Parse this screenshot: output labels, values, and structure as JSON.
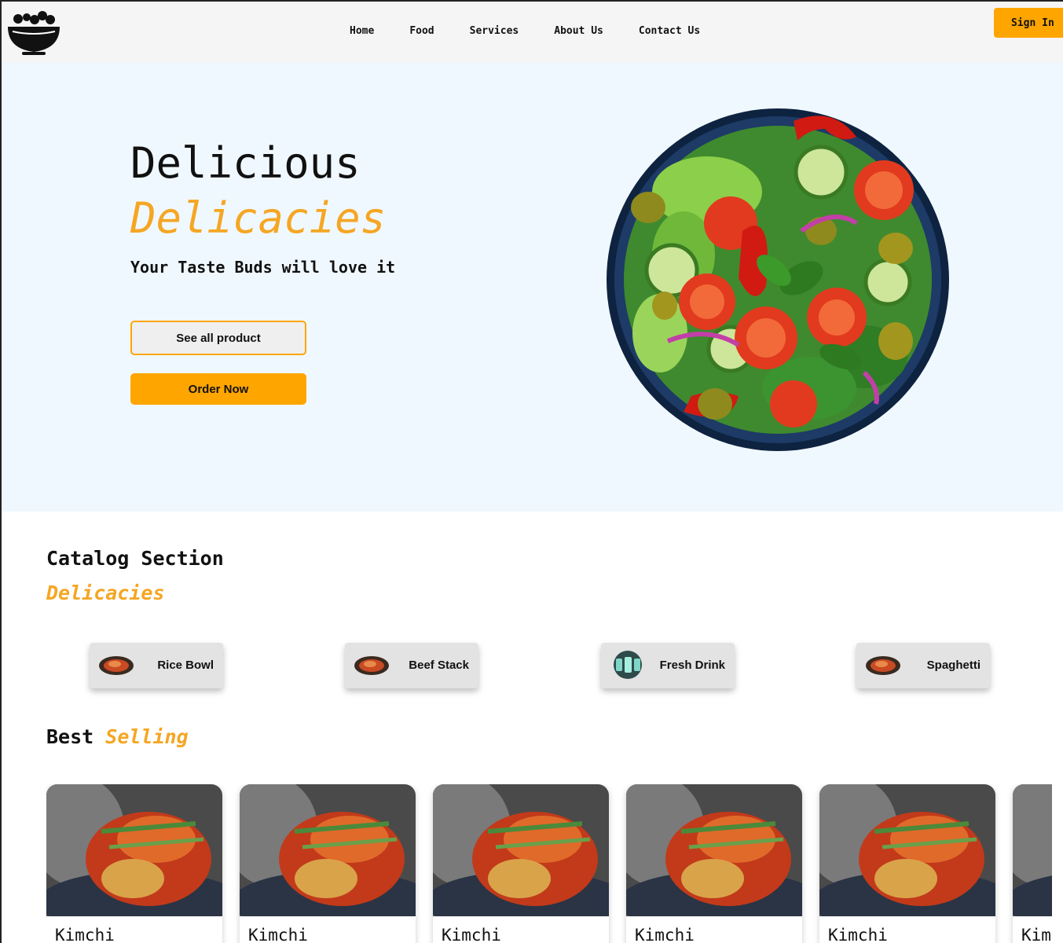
{
  "nav": {
    "links": [
      "Home",
      "Food",
      "Services",
      "About Us",
      "Contact Us"
    ],
    "signin_label": "Sign In"
  },
  "hero": {
    "title_line1": "Delicious",
    "title_line2": "Delicacies",
    "subtitle": "Your Taste Buds will love it",
    "see_all_label": "See all product",
    "order_label": "Order Now",
    "image_icon": "salad-bowl-image"
  },
  "catalog": {
    "title": "Catalog Section",
    "subtitle": "Delicacies",
    "items": [
      {
        "label": "Rice Bowl",
        "icon": "rice-bowl-thumb"
      },
      {
        "label": "Beef Stack",
        "icon": "beef-stack-thumb"
      },
      {
        "label": "Fresh Drink",
        "icon": "fresh-drink-thumb"
      },
      {
        "label": "Spaghetti",
        "icon": "spaghetti-thumb"
      }
    ]
  },
  "best_selling": {
    "title_word1": "Best",
    "title_word2": "Selling",
    "products": [
      {
        "name": "Kimchi"
      },
      {
        "name": "Kimchi"
      },
      {
        "name": "Kimchi"
      },
      {
        "name": "Kimchi"
      },
      {
        "name": "Kimchi"
      },
      {
        "name": "Kimchi"
      }
    ]
  },
  "colors": {
    "accent": "#ffa500",
    "accent_text": "#f5a623",
    "hero_bg": "#f0f8ff",
    "nav_bg": "#f5f5f5"
  }
}
